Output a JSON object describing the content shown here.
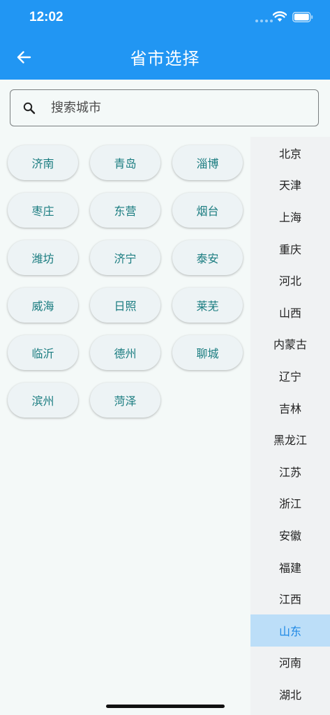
{
  "status_bar": {
    "time": "12:02"
  },
  "header": {
    "title": "省市选择"
  },
  "search": {
    "placeholder": "搜索城市",
    "value": ""
  },
  "cities": [
    "济南",
    "青岛",
    "淄博",
    "枣庄",
    "东营",
    "烟台",
    "潍坊",
    "济宁",
    "泰安",
    "威海",
    "日照",
    "莱芜",
    "临沂",
    "德州",
    "聊城",
    "滨州",
    "菏泽"
  ],
  "provinces": [
    "北京",
    "天津",
    "上海",
    "重庆",
    "河北",
    "山西",
    "内蒙古",
    "辽宁",
    "吉林",
    "黑龙江",
    "江苏",
    "浙江",
    "安徽",
    "福建",
    "江西",
    "山东",
    "河南",
    "湖北"
  ],
  "selected_province": "山东",
  "colors": {
    "app_bar": "#2196f3",
    "chip_text": "#1a7c80",
    "selected_bg": "#bcdef8",
    "selected_text": "#1e88e5"
  },
  "icons": {
    "back": "arrow-back-icon",
    "search": "search-icon",
    "wifi": "wifi-icon",
    "battery": "battery-icon"
  }
}
